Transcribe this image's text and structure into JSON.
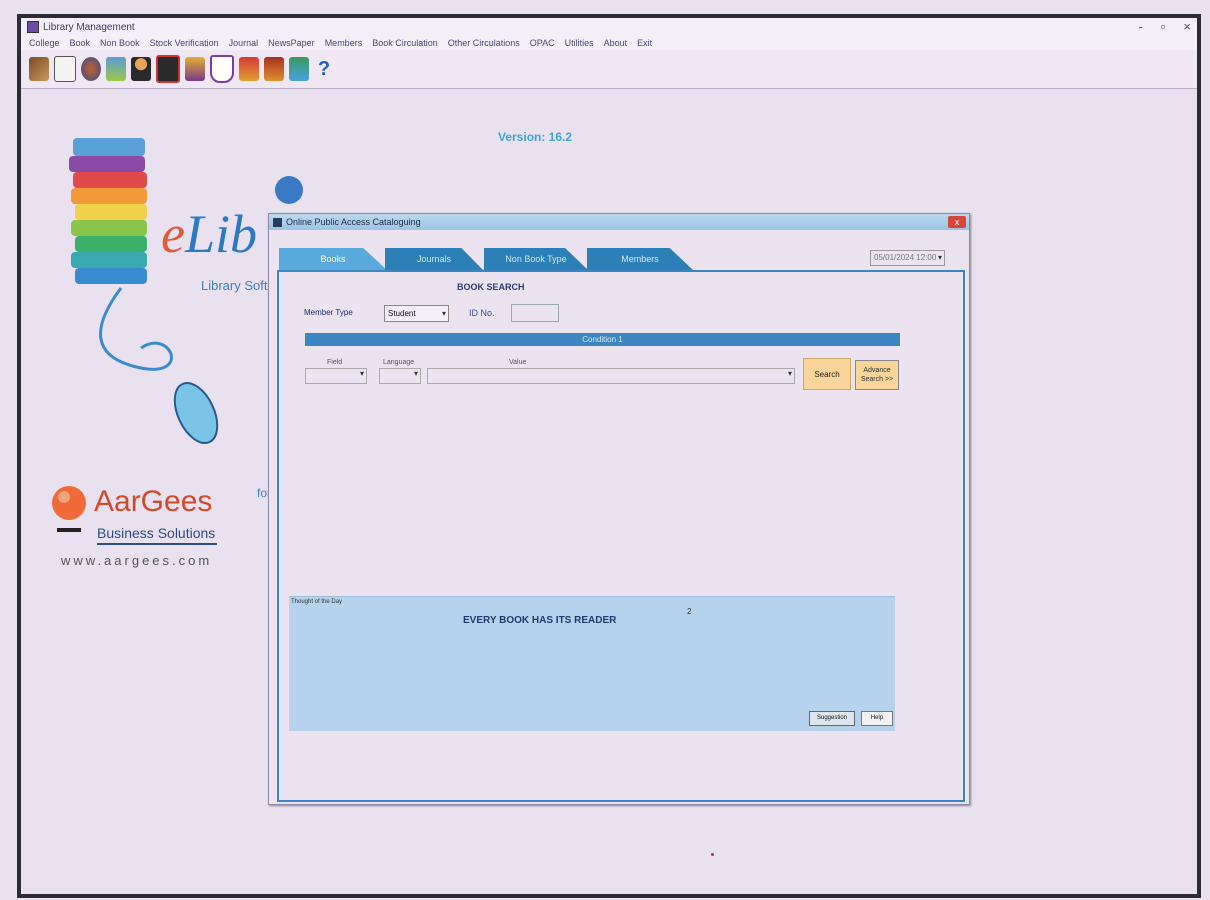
{
  "window": {
    "title": "Library Management",
    "controls": [
      "-",
      "▫",
      "×"
    ]
  },
  "menu": [
    "College",
    "Book",
    "Non Book",
    "Stock Verification",
    "Journal",
    "NewsPaper",
    "Members",
    "Book Circulation",
    "Other Circulations",
    "OPAC",
    "Utilities",
    "About",
    "Exit"
  ],
  "toolbar": {
    "icons": [
      "books-icon",
      "catalog-icon",
      "member-icon",
      "document-icon",
      "user-icon",
      "card-icon",
      "journal-icon",
      "shield-icon",
      "heart-icon",
      "book-issue-icon",
      "stats-icon",
      "help-icon"
    ]
  },
  "version": "Version: 16.2",
  "branding": {
    "elib_e": "e",
    "elib_rest": "Lib",
    "tagline": "Library Soft",
    "for_text": "for",
    "company_name": "AarGees",
    "company_sub": "Business Solutions",
    "company_url": "www.aargees.com"
  },
  "dialog": {
    "title": "Online Public Access Cataloguing",
    "close_label": "x",
    "tabs": [
      "Books",
      "Journals",
      "Non Book Type",
      "Members"
    ],
    "active_tab": 0,
    "date_value": "05/01/2024 12:00",
    "heading": "BOOK SEARCH",
    "member_type_label": "Member Type",
    "member_type_value": "Student",
    "id_no_label": "ID No.",
    "condition_label": "Condition 1",
    "field_label": "Field",
    "language_label": "Language",
    "value_label": "Value",
    "search_button": "Search",
    "advance_button": "Advance Search >>",
    "thought_label": "Thought of the Day",
    "thought_text": "EVERY BOOK HAS ITS READER",
    "thought_number": "2",
    "suggestion_button": "Suggestion",
    "help_button": "Help"
  },
  "colors": {
    "tab_active": "#5aa9dc",
    "tab": "#2d7fb8",
    "button_accent": "#f9d59a",
    "thought_panel": "#b6d2ec"
  }
}
